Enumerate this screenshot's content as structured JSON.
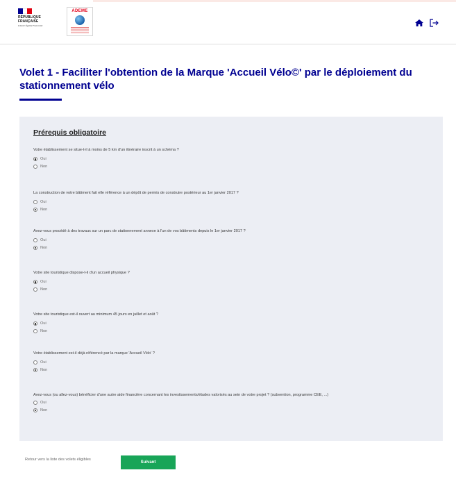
{
  "header": {
    "republic_logo_text": "RÉPUBLIQUE FRANÇAISE",
    "republic_motto": "Liberté Égalité Fraternité",
    "partner_logo_text": "ADEME",
    "flag_colors": [
      "#000091",
      "#ffffff",
      "#e1000f"
    ],
    "icons": [
      "home-icon",
      "logout-icon"
    ]
  },
  "page": {
    "title": "Volet 1 - Faciliter l'obtention de la Marque 'Accueil Vélo©' par le déploiement du stationnement vélo",
    "accent_color": "#000091"
  },
  "form": {
    "section_title": "Prérequis obligatoire",
    "questions": [
      {
        "label": "Votre établissement se situe-t-il à moins de 5 km d'un itinéraire inscrit à un schéma ?",
        "options": [
          "Oui",
          "Non"
        ],
        "selected": "Oui"
      },
      {
        "label": "La construction de votre bâtiment fait elle référence à un dépôt de permis de construire postérieur au 1er janvier 2017 ?",
        "options": [
          "Oui",
          "Non"
        ],
        "selected": "Non"
      },
      {
        "label": "Avez-vous procédé à des travaux sur un parc de stationnement annexe à l'un de vos bâtiments depuis le 1er janvier 2017 ?",
        "options": [
          "Oui",
          "Non"
        ],
        "selected": "Non"
      },
      {
        "label": "Votre site touristique dispose-t-il d'un accueil physique ?",
        "options": [
          "Oui",
          "Non"
        ],
        "selected": "Oui"
      },
      {
        "label": "Votre site touristique est-il ouvert au minimum 45 jours en juillet et août ?",
        "options": [
          "Oui",
          "Non"
        ],
        "selected": "Oui"
      },
      {
        "label": "Votre établissement est-il déjà référencé par la marque 'Accueil Vélo' ?",
        "options": [
          "Oui",
          "Non"
        ],
        "selected": "Non"
      },
      {
        "label": "Avez-vous (ou allez-vous) bénéficier d'une autre aide financière concernant les investissements/études valorisés au sein de votre projet ? (subvention, programme CEE, ...)",
        "options": [
          "Oui",
          "Non"
        ],
        "selected": "Non"
      }
    ]
  },
  "footer": {
    "back_link": "Retour vers la liste des volets éligibles",
    "next_button": "Suivant",
    "next_button_color": "#18a558"
  }
}
